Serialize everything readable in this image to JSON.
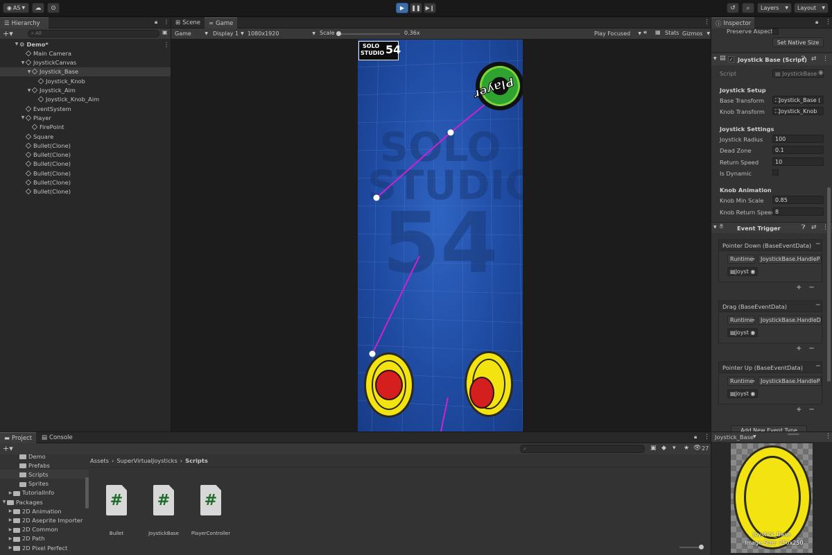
{
  "toolbar": {
    "account": "AS",
    "layers": "Layers",
    "layout": "Layout"
  },
  "hierarchy": {
    "tab": "Hierarchy",
    "search_placeholder": "All",
    "items": [
      {
        "label": "Demo*",
        "indent": 0,
        "caret": "▼",
        "kind": "scene"
      },
      {
        "label": "Main Camera",
        "indent": 1,
        "caret": "",
        "kind": "go"
      },
      {
        "label": "JoystickCanvas",
        "indent": 1,
        "caret": "▼",
        "kind": "go"
      },
      {
        "label": "Joystick_Base",
        "indent": 2,
        "caret": "▼",
        "kind": "go"
      },
      {
        "label": "Joystick_Knob",
        "indent": 3,
        "caret": "",
        "kind": "go"
      },
      {
        "label": "Joystick_Aim",
        "indent": 2,
        "caret": "▼",
        "kind": "go"
      },
      {
        "label": "Joystick_Knob_Aim",
        "indent": 3,
        "caret": "",
        "kind": "go"
      },
      {
        "label": "EventSystem",
        "indent": 1,
        "caret": "",
        "kind": "go"
      },
      {
        "label": "Player",
        "indent": 1,
        "caret": "▼",
        "kind": "go"
      },
      {
        "label": "FirePoint",
        "indent": 2,
        "caret": "",
        "kind": "go"
      },
      {
        "label": "Square",
        "indent": 1,
        "caret": "",
        "kind": "go"
      },
      {
        "label": "Bullet(Clone)",
        "indent": 1,
        "caret": "",
        "kind": "go"
      },
      {
        "label": "Bullet(Clone)",
        "indent": 1,
        "caret": "",
        "kind": "go"
      },
      {
        "label": "Bullet(Clone)",
        "indent": 1,
        "caret": "",
        "kind": "go"
      },
      {
        "label": "Bullet(Clone)",
        "indent": 1,
        "caret": "",
        "kind": "go"
      },
      {
        "label": "Bullet(Clone)",
        "indent": 1,
        "caret": "",
        "kind": "go"
      },
      {
        "label": "Bullet(Clone)",
        "indent": 1,
        "caret": "",
        "kind": "go"
      }
    ]
  },
  "view": {
    "tab_scene": "Scene",
    "tab_game": "Game",
    "game_dropdown": "Game",
    "display": "Display 1",
    "resolution": "1080x1920",
    "scale_label": "Scale",
    "scale_value": "0.36x",
    "play_focused": "Play Focused",
    "stats": "Stats",
    "gizmos": "Gizmos"
  },
  "game": {
    "logo_line1": "SOLO",
    "logo_line2": "STUDIO",
    "logo_num": "54",
    "player_label": "Player",
    "watermark1": "SOLO",
    "watermark2": "STUDIO",
    "watermark3": "54"
  },
  "inspector": {
    "tab": "Inspector",
    "preserve_aspect": "Preserve Aspect",
    "set_native_size": "Set Native Size",
    "component_title": "Joystick Base (Script)",
    "script_label": "Script",
    "script_value": "JoystickBase",
    "setup_header": "Joystick Setup",
    "base_transform_label": "Base Transform",
    "base_transform_value": "Joystick_Base (",
    "knob_transform_label": "Knob Transform",
    "knob_transform_value": "Joystick_Knob",
    "settings_header": "Joystick Settings",
    "radius_label": "Joystick Radius",
    "radius_value": "100",
    "deadzone_label": "Dead Zone",
    "deadzone_value": "0.1",
    "return_speed_label": "Return Speed",
    "return_speed_value": "10",
    "dynamic_label": "Is Dynamic",
    "anim_header": "Knob Animation",
    "min_scale_label": "Knob Min Scale",
    "min_scale_value": "0.85",
    "knob_return_label": "Knob Return Speed",
    "knob_return_value": "8",
    "event_trigger_title": "Event Trigger",
    "events": [
      {
        "title": "Pointer Down (BaseEventData)",
        "runtime": "Runtime",
        "method": "JoystickBase.HandleP",
        "target": "Joyst"
      },
      {
        "title": "Drag (BaseEventData)",
        "runtime": "Runtime",
        "method": "JoystickBase.HandleD",
        "target": "Joyst"
      },
      {
        "title": "Pointer Up (BaseEventData)",
        "runtime": "Runtime",
        "method": "JoystickBase.HandleP",
        "target": "Joyst"
      }
    ],
    "add_event": "Add New Event Type"
  },
  "project": {
    "tab_project": "Project",
    "tab_console": "Console",
    "breadcrumb": [
      "Assets",
      "SuperVirtualJoysticks",
      "Scripts"
    ],
    "hidden_count": "27",
    "tree": [
      {
        "label": "Demo",
        "indent": 2,
        "caret": ""
      },
      {
        "label": "Prefabs",
        "indent": 2,
        "caret": ""
      },
      {
        "label": "Scripts",
        "indent": 2,
        "caret": ""
      },
      {
        "label": "Sprites",
        "indent": 2,
        "caret": ""
      },
      {
        "label": "TutorialInfo",
        "indent": 1,
        "caret": "▶"
      },
      {
        "label": "Packages",
        "indent": 0,
        "caret": "▼"
      },
      {
        "label": "2D Animation",
        "indent": 1,
        "caret": "▶"
      },
      {
        "label": "2D Aseprite Importer",
        "indent": 1,
        "caret": "▶"
      },
      {
        "label": "2D Common",
        "indent": 1,
        "caret": "▶"
      },
      {
        "label": "2D Path",
        "indent": 1,
        "caret": "▶"
      },
      {
        "label": "2D Pixel Perfect",
        "indent": 1,
        "caret": "▶"
      }
    ],
    "files": [
      "Bullet",
      "JoystickBase",
      "PlayerController"
    ]
  },
  "preview": {
    "title": "Joystick_Base",
    "caption1": "Joystick_Base",
    "caption2": "Image Size: 250x250"
  }
}
